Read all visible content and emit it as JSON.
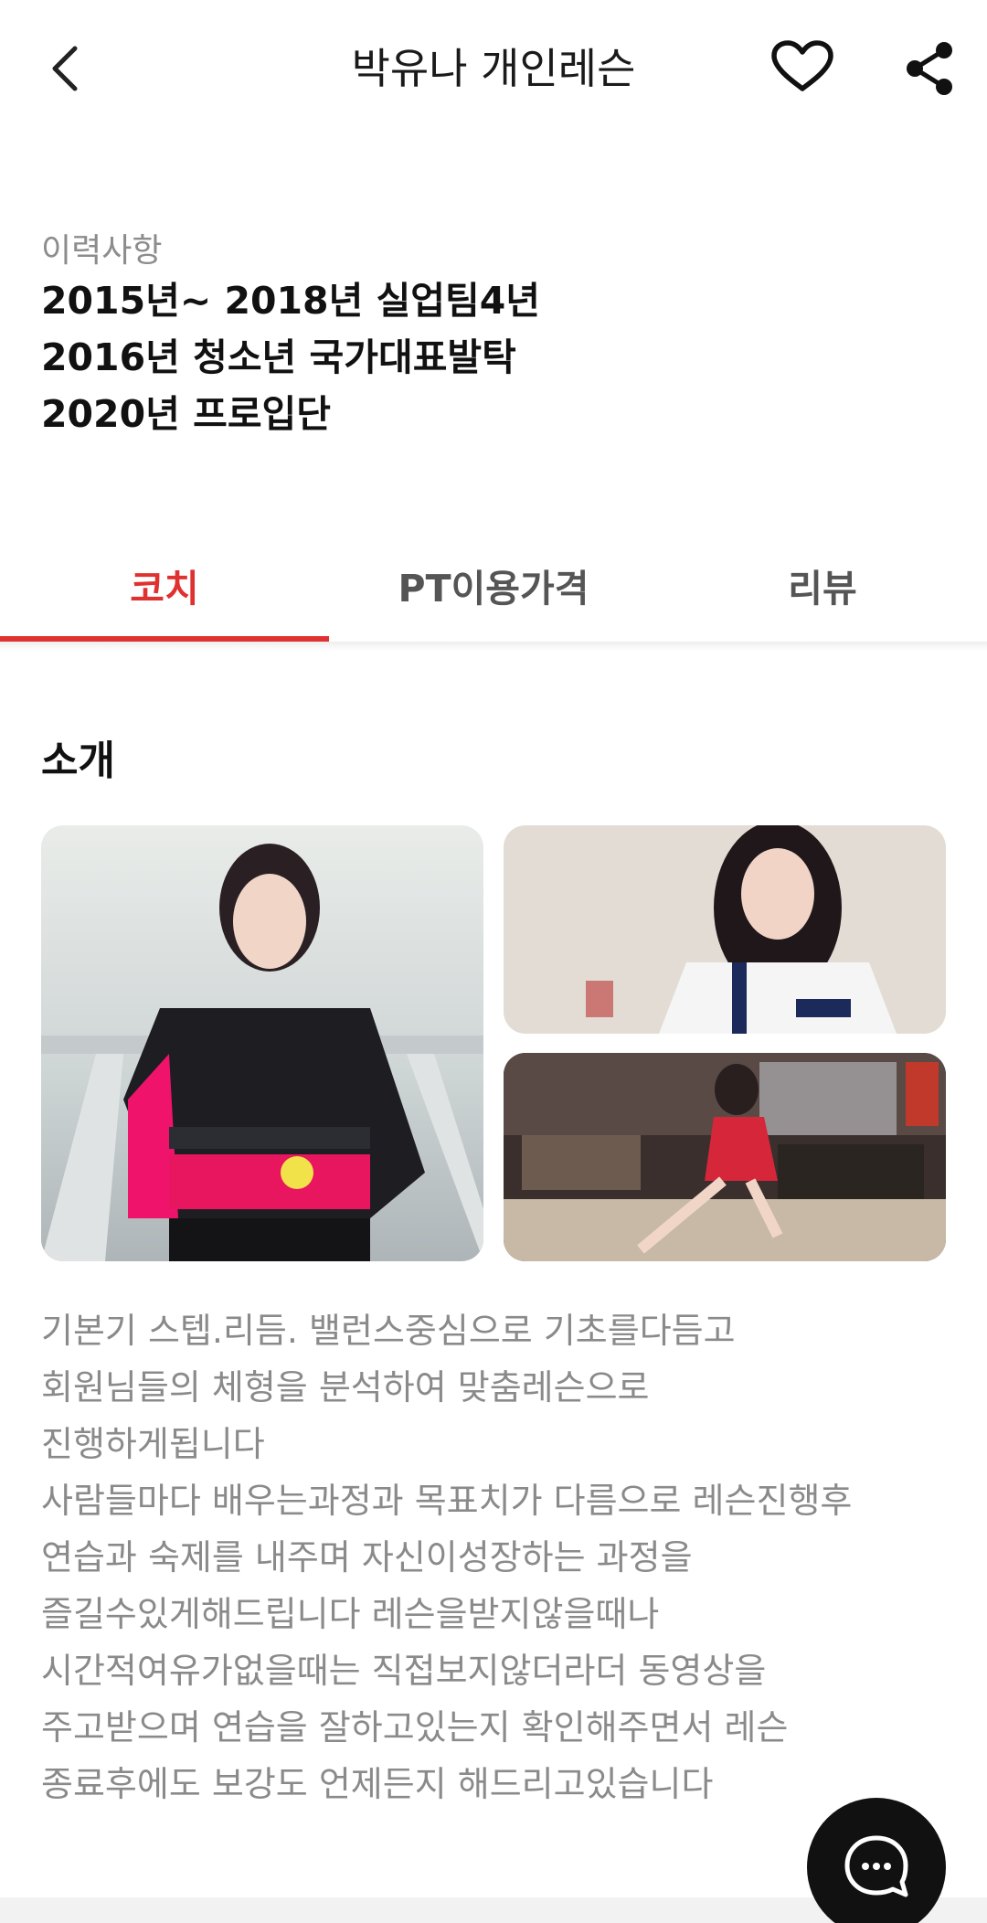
{
  "header": {
    "title": "박유나 개인레슨",
    "back_icon": "chevron-left-icon",
    "favorite_icon": "heart-outline-icon",
    "share_icon": "share-icon"
  },
  "career": {
    "label": "이력사항",
    "lines": [
      "2015년~ 2018년 실업팀4년",
      "2016년 청소년 국가대표발탁",
      "2020년 프로입단"
    ]
  },
  "tabs": [
    {
      "label": "코치",
      "active": true
    },
    {
      "label": "PT이용가격",
      "active": false
    },
    {
      "label": "리뷰",
      "active": false
    }
  ],
  "intro": {
    "heading": "소개",
    "description_lines": [
      "기본기 스텝.리듬. 밸런스중심으로 기초를다듬고",
      "회원님들의 체형을 분석하여 맞춤레슨으로",
      "진행하게됩니다",
      "사람들마다 배우는과정과 목표치가 다름으로 레슨진행후",
      "연습과 숙제를 내주며 자신이성장하는 과정을",
      "즐길수있게해드립니다 레슨을받지않을때나",
      "시간적여유가없을때는 직접보지않더라더 동영상을",
      "주고받으며 연습을 잘하고있는지 확인해주면서 레슨",
      "종료후에도 보강도 언제든지 해드리고있습니다"
    ]
  },
  "chat": {
    "icon": "chat-bubble-icon"
  },
  "colors": {
    "accent": "#e03131",
    "text_primary": "#111111",
    "text_secondary": "#8a8a8a",
    "fab_background": "#111111"
  }
}
